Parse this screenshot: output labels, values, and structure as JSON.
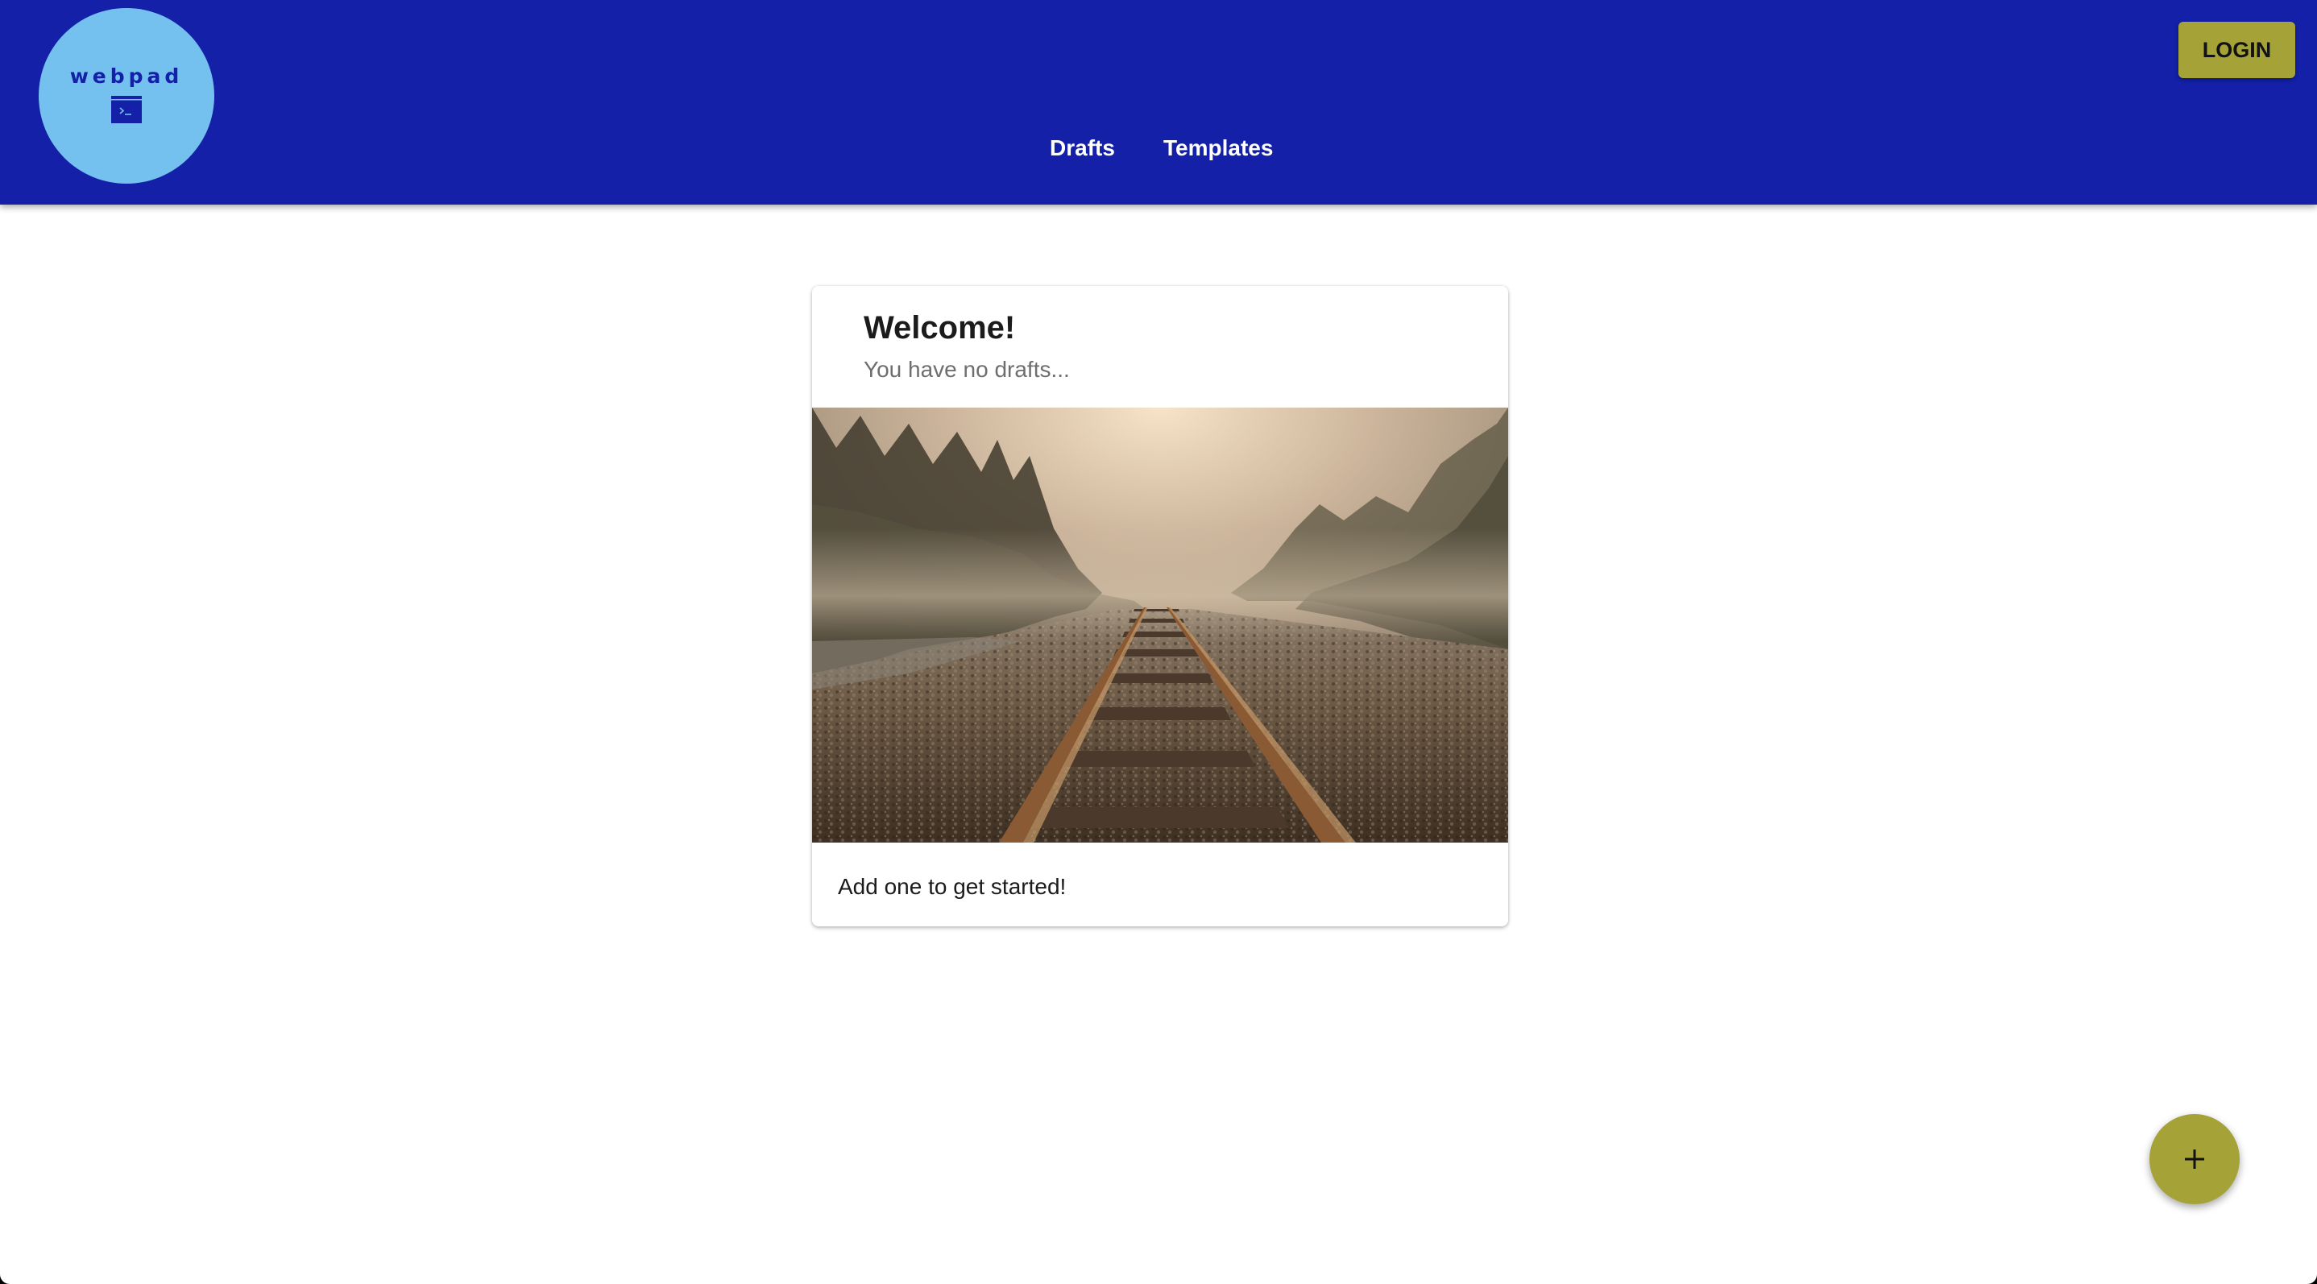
{
  "app": {
    "logo_text": "webpad",
    "logo_icon": "terminal-icon"
  },
  "header": {
    "nav": [
      {
        "label": "Drafts"
      },
      {
        "label": "Templates"
      }
    ],
    "login_label": "LOGIN"
  },
  "card": {
    "title": "Welcome!",
    "subtitle": "You have no drafts...",
    "body": "Add one to get started!",
    "image": "foggy-railroad-tracks-photo"
  },
  "fab": {
    "icon": "plus-icon"
  },
  "colors": {
    "appbar": "#1320a7",
    "logo_circle": "#74c0ee",
    "accent": "#a5a237",
    "background": "#ffffff"
  }
}
